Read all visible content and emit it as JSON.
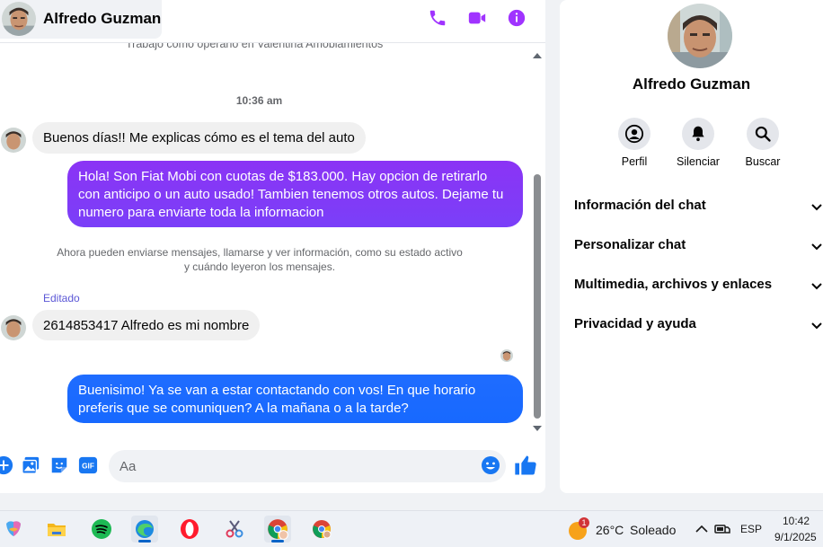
{
  "header": {
    "contact_name": "Alfredo Guzman",
    "icons": [
      "phone-icon",
      "video-icon",
      "info-icon"
    ]
  },
  "colors": {
    "accent": "#a033ff",
    "outgoing_gradient_top": "#8b34f5",
    "outgoing_gradient_bottom": "#1769ff",
    "incoming": "#f0f0f0",
    "edited": "#5b57d6"
  },
  "messages": {
    "truncated_top": "Trabajo como operario en Valentina Amoblamientos",
    "timestamp": "10:36 am",
    "items": [
      {
        "direction": "in",
        "text": "Buenos días!! Me explicas cómo es el tema del auto"
      },
      {
        "direction": "out",
        "text": "Hola! Son Fiat Mobi con cuotas de $183.000. Hay opcion de retirarlo con anticipo o un auto usado! Tambien tenemos otros autos. Dejame tu numero para enviarte toda la informacion"
      },
      {
        "direction": "in",
        "text": "2614853417 Alfredo es mi nombre"
      },
      {
        "direction": "out",
        "text": "Buenisimo! Ya se van a estar contactando con vos! En que horario preferis que se comuniquen? A la mañana o a la tarde?"
      }
    ],
    "system_note": "Ahora pueden enviarse mensajes, llamarse y ver información, como su estado activo y cuándo leyeron los mensajes.",
    "edited_label": "Editado"
  },
  "composer": {
    "placeholder": "Aa",
    "icons": [
      "add-icon",
      "image-icon",
      "sticker-icon",
      "gif-icon",
      "emoji-icon",
      "like-icon"
    ],
    "gif_label": "GIF"
  },
  "sidebar": {
    "name": "Alfredo Guzman",
    "actions": [
      {
        "label": "Perfil",
        "icon": "profile-icon"
      },
      {
        "label": "Silenciar",
        "icon": "bell-icon"
      },
      {
        "label": "Buscar",
        "icon": "search-icon"
      }
    ],
    "sections": [
      "Información del chat",
      "Personalizar chat",
      "Multimedia, archivos y enlaces",
      "Privacidad y ayuda"
    ]
  },
  "taskbar": {
    "apps": [
      "copilot-icon",
      "file-explorer-icon",
      "spotify-icon",
      "edge-icon",
      "opera-icon",
      "snipping-tool-icon",
      "chrome-profile-icon",
      "chrome-icon"
    ],
    "weather": {
      "temp": "26°C",
      "condition": "Soleado",
      "badge": "1"
    },
    "language": "ESP",
    "time": "10:42",
    "date": "9/1/2025"
  }
}
